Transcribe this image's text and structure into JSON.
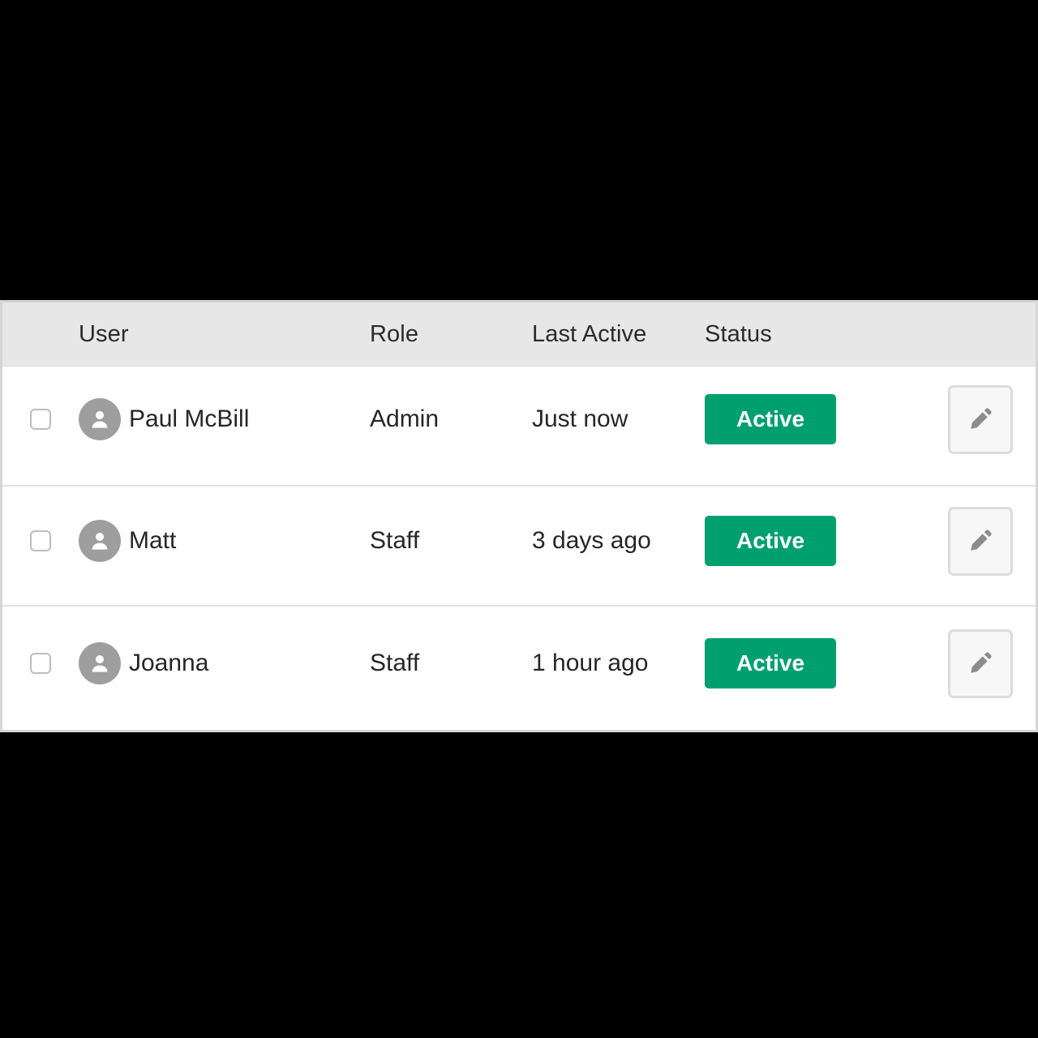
{
  "theme": {
    "page_background": "#000000",
    "panel_background": "#ffffff",
    "header_background": "#e7e7e7",
    "status_green": "#00a06e",
    "avatar_gray": "#9e9e9e",
    "text_color": "#262626",
    "border_gray": "#dcdcdc"
  },
  "table": {
    "columns": [
      {
        "key": "select",
        "label": ""
      },
      {
        "key": "user",
        "label": "User"
      },
      {
        "key": "role",
        "label": "Role"
      },
      {
        "key": "last_active",
        "label": "Last Active"
      },
      {
        "key": "status",
        "label": "Status"
      },
      {
        "key": "actions",
        "label": ""
      }
    ],
    "header": {
      "user": "User",
      "role": "Role",
      "last_active": "Last Active",
      "status": "Status"
    },
    "rows": [
      {
        "name": "Paul McBill",
        "role": "Admin",
        "last_active": "Just now",
        "status": "Active",
        "selected": false,
        "avatar_icon": "user-avatar-icon",
        "edit_icon": "pencil-icon"
      },
      {
        "name": "Matt",
        "role": "Staff",
        "last_active": "3 days ago",
        "status": "Active",
        "selected": false,
        "avatar_icon": "user-avatar-icon",
        "edit_icon": "pencil-icon"
      },
      {
        "name": "Joanna",
        "role": "Staff",
        "last_active": "1 hour ago",
        "status": "Active",
        "selected": false,
        "avatar_icon": "user-avatar-icon",
        "edit_icon": "pencil-icon"
      }
    ]
  }
}
